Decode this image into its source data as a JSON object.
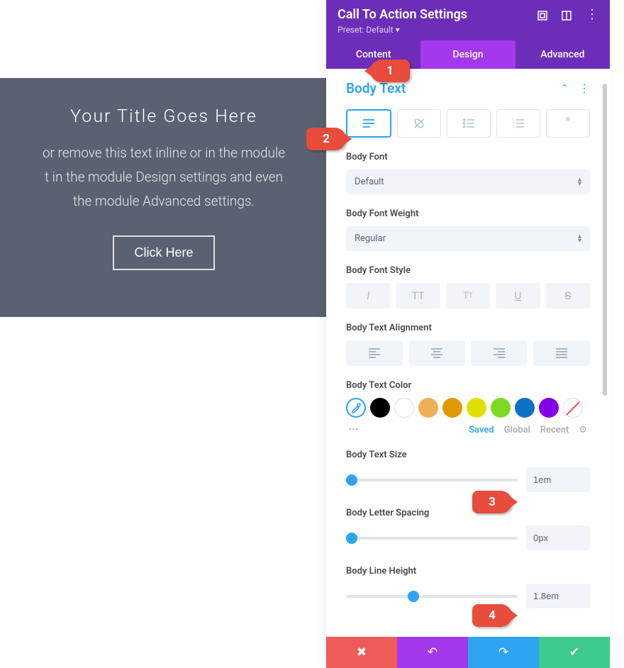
{
  "preview": {
    "title": "Your Title Goes Here",
    "body_line1": "or remove this text inline or in the module",
    "body_line2": "t in the module Design settings and even",
    "body_line3": "the module Advanced settings.",
    "button_label": "Click Here"
  },
  "panel": {
    "title": "Call To Action Settings",
    "preset_label": "Preset: Default",
    "tabs": {
      "content": "Content",
      "design": "Design",
      "advanced": "Advanced"
    }
  },
  "section": {
    "title": "Body Text",
    "font_label": "Body Font",
    "font_value": "Default",
    "weight_label": "Body Font Weight",
    "weight_value": "Regular",
    "style_label": "Body Font Style",
    "align_label": "Body Text Alignment",
    "color_label": "Body Text Color",
    "size_label": "Body Text Size",
    "size_value": "1em",
    "spacing_label": "Body Letter Spacing",
    "spacing_value": "0px",
    "lineheight_label": "Body Line Height",
    "lineheight_value": "1.8em"
  },
  "color_tabs": {
    "saved": "Saved",
    "global": "Global",
    "recent": "Recent"
  },
  "callouts": {
    "c1": "1",
    "c2": "2",
    "c3": "3",
    "c4": "4"
  }
}
